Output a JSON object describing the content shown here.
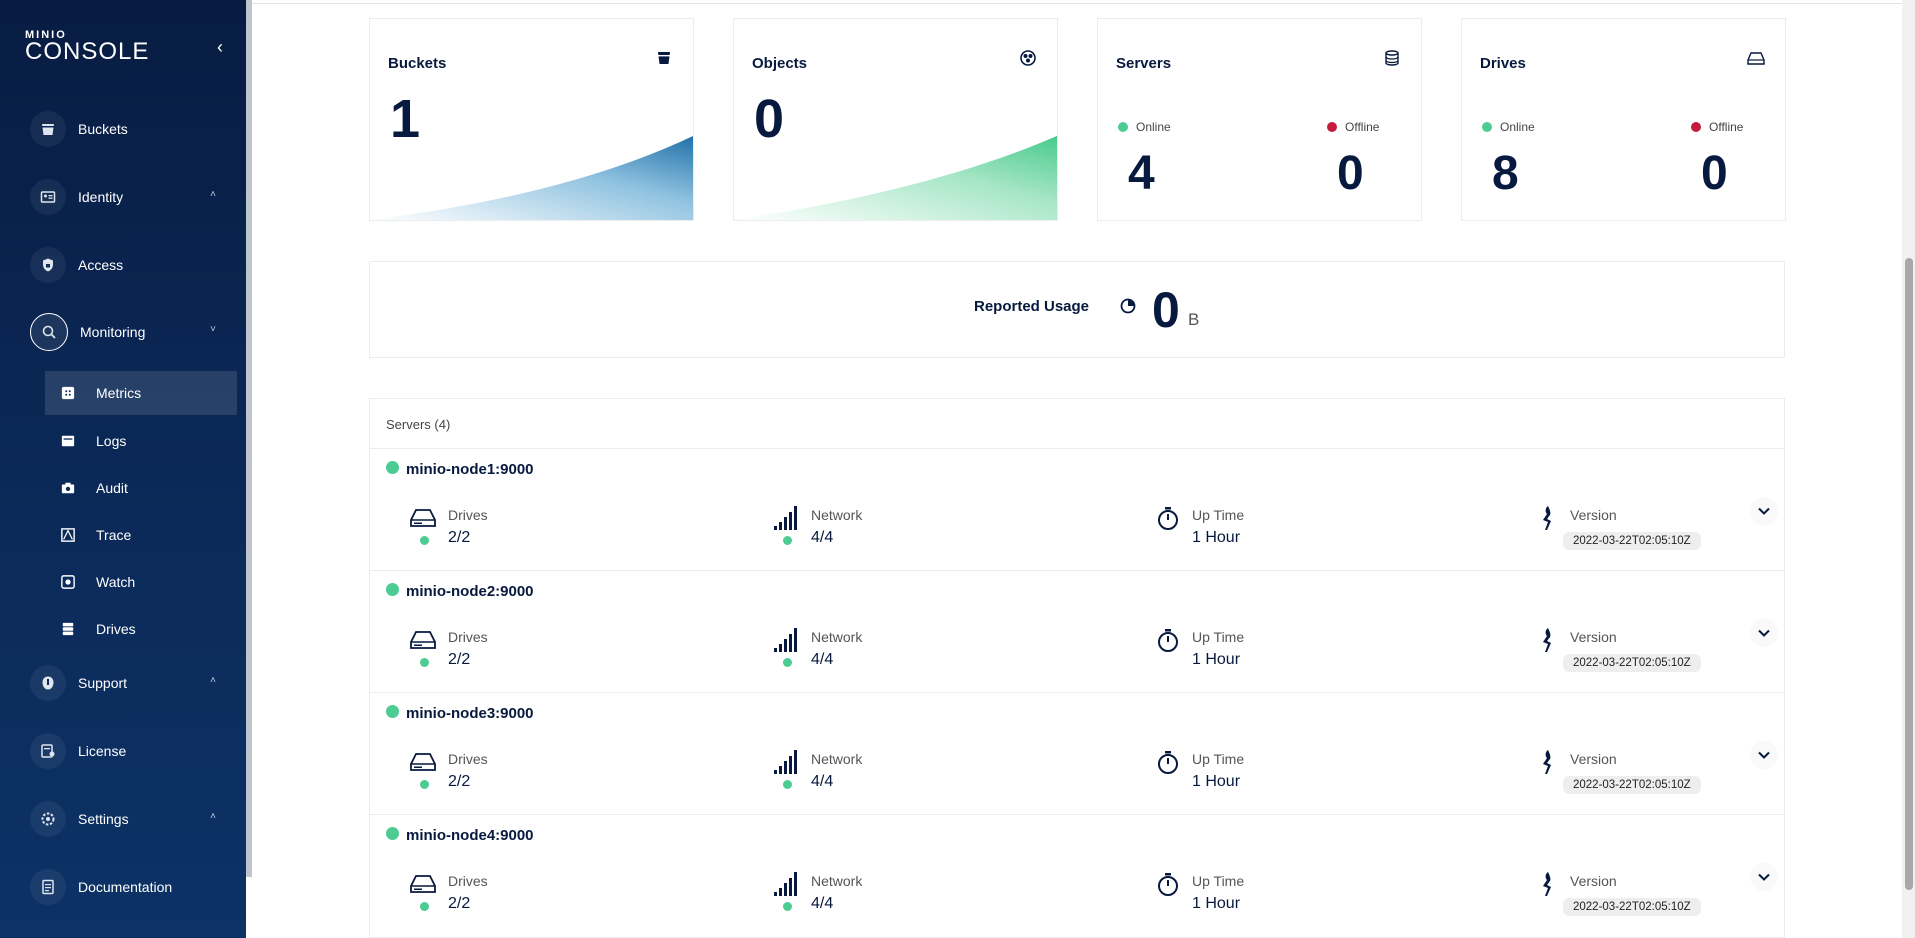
{
  "brand": {
    "small": "MINIO",
    "big": "CONSOLE"
  },
  "sidebar": {
    "collapse_icon": "chevron-left-icon",
    "items": [
      {
        "label": "Buckets",
        "icon": "bucket-icon"
      },
      {
        "label": "Identity",
        "icon": "identity-icon",
        "chevron": "˄"
      },
      {
        "label": "Access",
        "icon": "lock-icon"
      },
      {
        "label": "Monitoring",
        "icon": "monitoring-icon",
        "chevron": "˅"
      },
      {
        "label": "Support",
        "icon": "support-icon",
        "chevron": "˄"
      },
      {
        "label": "License",
        "icon": "license-icon"
      },
      {
        "label": "Settings",
        "icon": "settings-icon",
        "chevron": "˄"
      },
      {
        "label": "Documentation",
        "icon": "documentation-icon"
      }
    ],
    "sub_items": [
      {
        "label": "Metrics",
        "icon": "metrics-icon",
        "selected": true
      },
      {
        "label": "Logs",
        "icon": "logs-icon"
      },
      {
        "label": "Audit",
        "icon": "audit-icon"
      },
      {
        "label": "Trace",
        "icon": "trace-icon"
      },
      {
        "label": "Watch",
        "icon": "watch-icon"
      },
      {
        "label": "Drives",
        "icon": "drives-icon"
      }
    ]
  },
  "cards": {
    "buckets": {
      "title": "Buckets",
      "value": "1"
    },
    "objects": {
      "title": "Objects",
      "value": "0"
    },
    "servers": {
      "title": "Servers",
      "online_label": "Online",
      "offline_label": "Offline",
      "online": "4",
      "offline": "0"
    },
    "drives": {
      "title": "Drives",
      "online_label": "Online",
      "offline_label": "Offline",
      "online": "8",
      "offline": "0"
    }
  },
  "usage": {
    "label": "Reported Usage",
    "value": "0",
    "unit": "B"
  },
  "servers_panel": {
    "title": "Servers (4)",
    "servers": [
      {
        "name": "minio-node1:9000",
        "drives_label": "Drives",
        "drives": "2/2",
        "network_label": "Network",
        "network": "4/4",
        "uptime_label": "Up Time",
        "uptime": "1 Hour",
        "version_label": "Version",
        "version": "2022-03-22T02:05:10Z"
      },
      {
        "name": "minio-node2:9000",
        "drives_label": "Drives",
        "drives": "2/2",
        "network_label": "Network",
        "network": "4/4",
        "uptime_label": "Up Time",
        "uptime": "1 Hour",
        "version_label": "Version",
        "version": "2022-03-22T02:05:10Z"
      },
      {
        "name": "minio-node3:9000",
        "drives_label": "Drives",
        "drives": "2/2",
        "network_label": "Network",
        "network": "4/4",
        "uptime_label": "Up Time",
        "uptime": "1 Hour",
        "version_label": "Version",
        "version": "2022-03-22T02:05:10Z"
      },
      {
        "name": "minio-node4:9000",
        "drives_label": "Drives",
        "drives": "2/2",
        "network_label": "Network",
        "network": "4/4",
        "uptime_label": "Up Time",
        "uptime": "1 Hour",
        "version_label": "Version",
        "version": "2022-03-22T02:05:10Z"
      }
    ]
  },
  "colors": {
    "sidebar": "#081c42",
    "online": "#4ccb92",
    "offline": "#c51b3f",
    "buckets_accent": "#2f82b9",
    "objects_accent": "#4ccb92"
  }
}
